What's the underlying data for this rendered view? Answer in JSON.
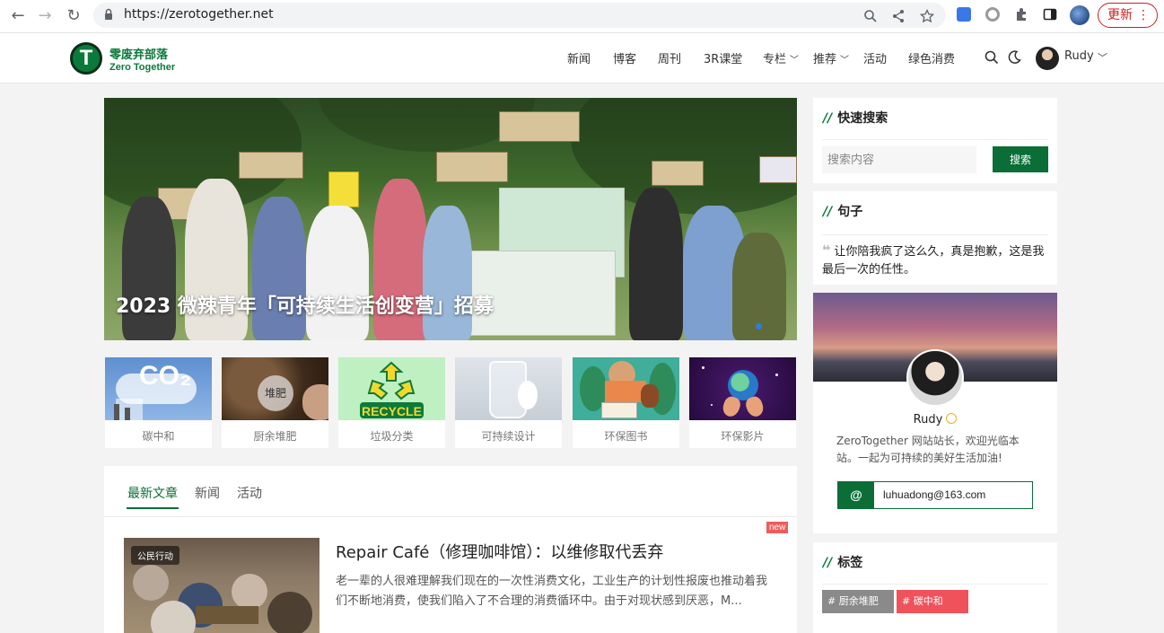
{
  "browser": {
    "url": "https://zerotogether.net",
    "update_label": "更新",
    "update_more": "⋮"
  },
  "site": {
    "logo_cn": "零废弃部落",
    "logo_en": "Zero Together",
    "nav": [
      {
        "label": "新闻"
      },
      {
        "label": "博客"
      },
      {
        "label": "周刊"
      },
      {
        "label": "3R课堂"
      },
      {
        "label": "专栏",
        "has_menu": true
      },
      {
        "label": "推荐",
        "has_menu": true
      },
      {
        "label": "活动"
      },
      {
        "label": "绿色消费"
      }
    ],
    "user": {
      "name": "Rudy"
    },
    "brand_color": "#0a6e36"
  },
  "hero": {
    "title": "2023 微辣青年「可持续生活创变营」招募"
  },
  "categories": [
    {
      "label": "碳中和",
      "thumb_text": "CO₂"
    },
    {
      "label": "厨余堆肥",
      "thumb_text": "堆肥"
    },
    {
      "label": "垃圾分类",
      "thumb_text": "RECYCLE"
    },
    {
      "label": "可持续设计"
    },
    {
      "label": "环保图书"
    },
    {
      "label": "环保影片"
    }
  ],
  "articles": {
    "tabs": [
      {
        "label": "最新文章",
        "active": true
      },
      {
        "label": "新闻"
      },
      {
        "label": "活动"
      }
    ],
    "items": [
      {
        "badge": "公民行动",
        "new_tag": "new",
        "title": "Repair Café（修理咖啡馆）：以维修取代丢弃",
        "excerpt": "老一辈的人很难理解我们现在的一次性消费文化，工业生产的计划性报废也推动着我们不断地消费，使我们陷入了不合理的消费循环中。由于对现状感到厌恶，M..."
      }
    ]
  },
  "sidebar": {
    "search": {
      "title": "快速搜索",
      "placeholder": "搜索内容",
      "button": "搜索"
    },
    "quote": {
      "title": "句子",
      "mark": "❝",
      "text": "让你陪我疯了这么久，真是抱歉，这是我最后一次的任性。"
    },
    "profile": {
      "name": "Rudy",
      "bio": "ZeroTogether 网站站长，欢迎光临本站。一起为可持续的美好生活加油!",
      "email_icon": "@",
      "email": "luhuadong@163.com"
    },
    "tags": {
      "title": "标签",
      "items": [
        {
          "label": "# 厨余堆肥",
          "color": "#8a8a8a"
        },
        {
          "label": "# 碳中和",
          "color": "#f0525c"
        }
      ]
    }
  }
}
